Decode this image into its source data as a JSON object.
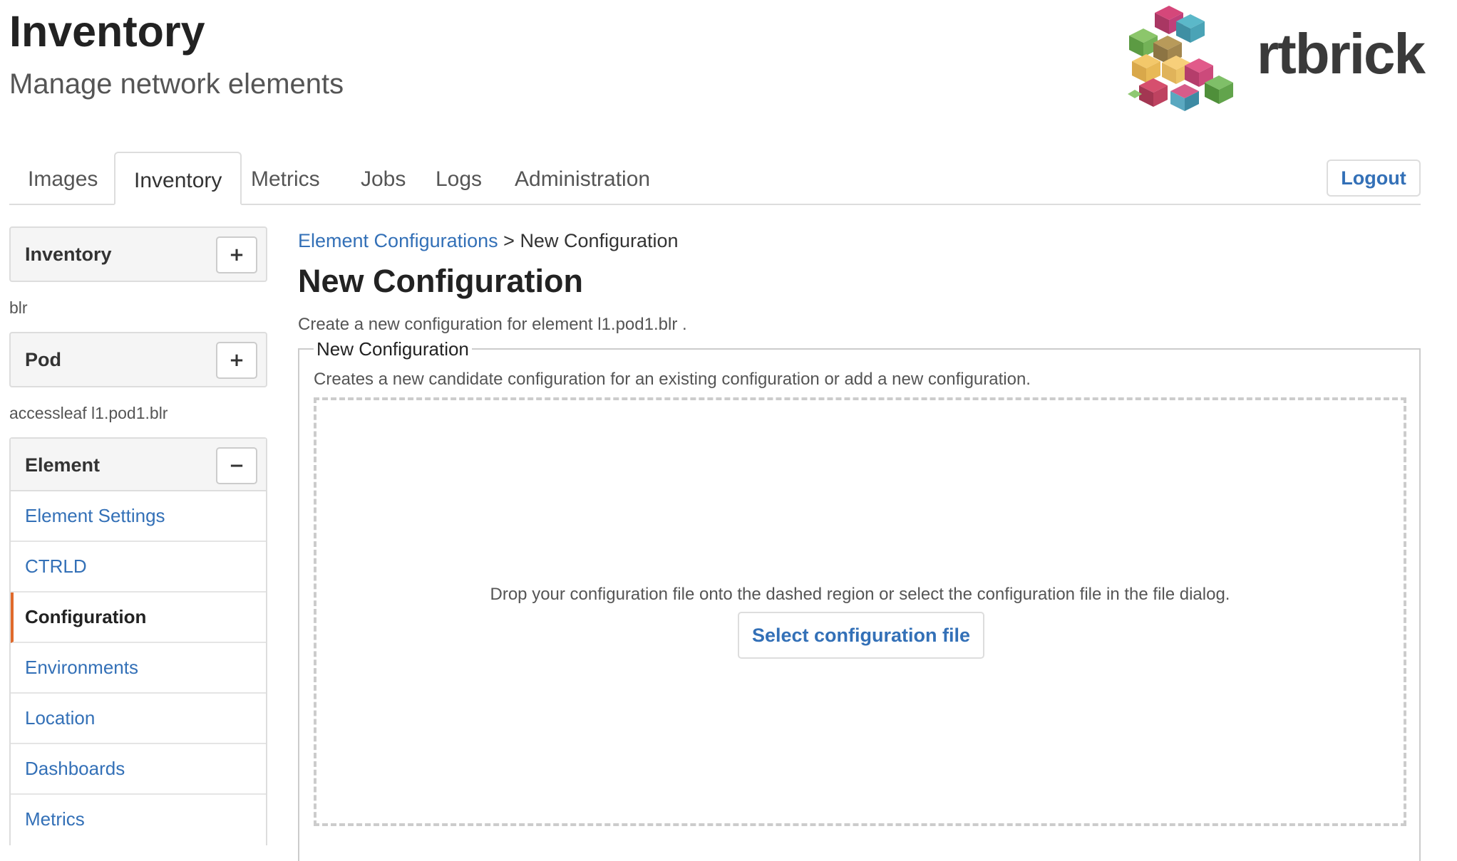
{
  "header": {
    "title": "Inventory",
    "subtitle": "Manage network elements",
    "logo_text": "rtbrick"
  },
  "tabs": [
    {
      "label": "Images",
      "active": false
    },
    {
      "label": "Inventory",
      "active": true
    },
    {
      "label": "Metrics",
      "active": false
    },
    {
      "label": "Jobs",
      "active": false
    },
    {
      "label": "Logs",
      "active": false
    },
    {
      "label": "Administration",
      "active": false
    }
  ],
  "logout_label": "Logout",
  "sidebar": {
    "inventory_panel": {
      "label": "Inventory",
      "button": "+"
    },
    "pod_caption": "blr",
    "pod_panel": {
      "label": "Pod",
      "button": "+"
    },
    "element_caption": "accessleaf l1.pod1.blr",
    "element_panel": {
      "label": "Element",
      "button": "−",
      "items": [
        {
          "label": "Element Settings",
          "active": false
        },
        {
          "label": "CTRLD",
          "active": false
        },
        {
          "label": "Configuration",
          "active": true
        },
        {
          "label": "Environments",
          "active": false
        },
        {
          "label": "Location",
          "active": false
        },
        {
          "label": "Dashboards",
          "active": false
        },
        {
          "label": "Metrics",
          "active": false
        }
      ]
    }
  },
  "main": {
    "breadcrumb": {
      "link": "Element Configurations",
      "separator": " > ",
      "current": "New Configuration"
    },
    "title": "New Configuration",
    "description": "Create a new configuration for element l1.pod1.blr .",
    "fieldset": {
      "legend": "New Configuration",
      "description": "Creates a new candidate configuration for an existing configuration or add a new configuration.",
      "dropzone_text": "Drop your configuration file onto the dashed region or select the configuration file in the file dialog.",
      "select_button": "Select configuration file"
    }
  },
  "colors": {
    "link": "#3370b7",
    "active_indicator": "#e06a2c",
    "border": "#dddddd",
    "panel_bg": "#f5f5f5"
  },
  "icons": {
    "add": "plus-icon",
    "collapse": "minus-icon",
    "logo": "rtbrick-cube-logo-icon"
  }
}
